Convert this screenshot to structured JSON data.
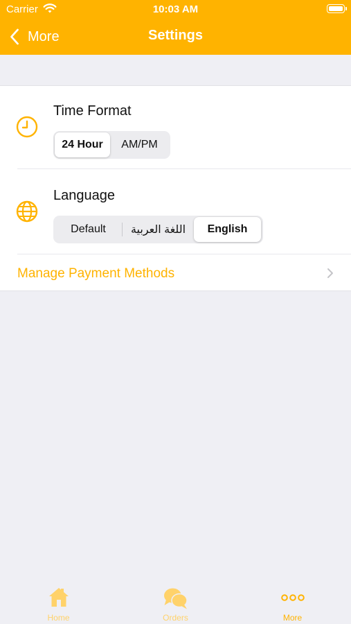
{
  "colors": {
    "accent": "#ffb300",
    "accent_light": "#ffd26a",
    "background": "#efeff4",
    "card": "#ffffff"
  },
  "status_bar": {
    "carrier": "Carrier",
    "time": "10:03 AM",
    "icons": [
      "wifi-icon",
      "battery-icon"
    ]
  },
  "nav": {
    "back_label": "More",
    "title": "Settings",
    "back_icon": "chevron-left-icon"
  },
  "settings": {
    "time_format": {
      "title": "Time Format",
      "icon": "clock-icon",
      "options": [
        "24 Hour",
        "AM/PM"
      ],
      "selected": "24 Hour"
    },
    "language": {
      "title": "Language",
      "icon": "globe-icon",
      "options": [
        "Default",
        "اللغة العربية",
        "English"
      ],
      "selected": "English"
    },
    "payment": {
      "label": "Manage Payment Methods",
      "icon": "chevron-right-icon"
    }
  },
  "tab_bar": {
    "tabs": [
      {
        "label": "Home",
        "icon": "home-icon",
        "active": false
      },
      {
        "label": "Orders",
        "icon": "chat-bubbles-icon",
        "active": false
      },
      {
        "label": "More",
        "icon": "more-dots-icon",
        "active": true
      }
    ]
  }
}
